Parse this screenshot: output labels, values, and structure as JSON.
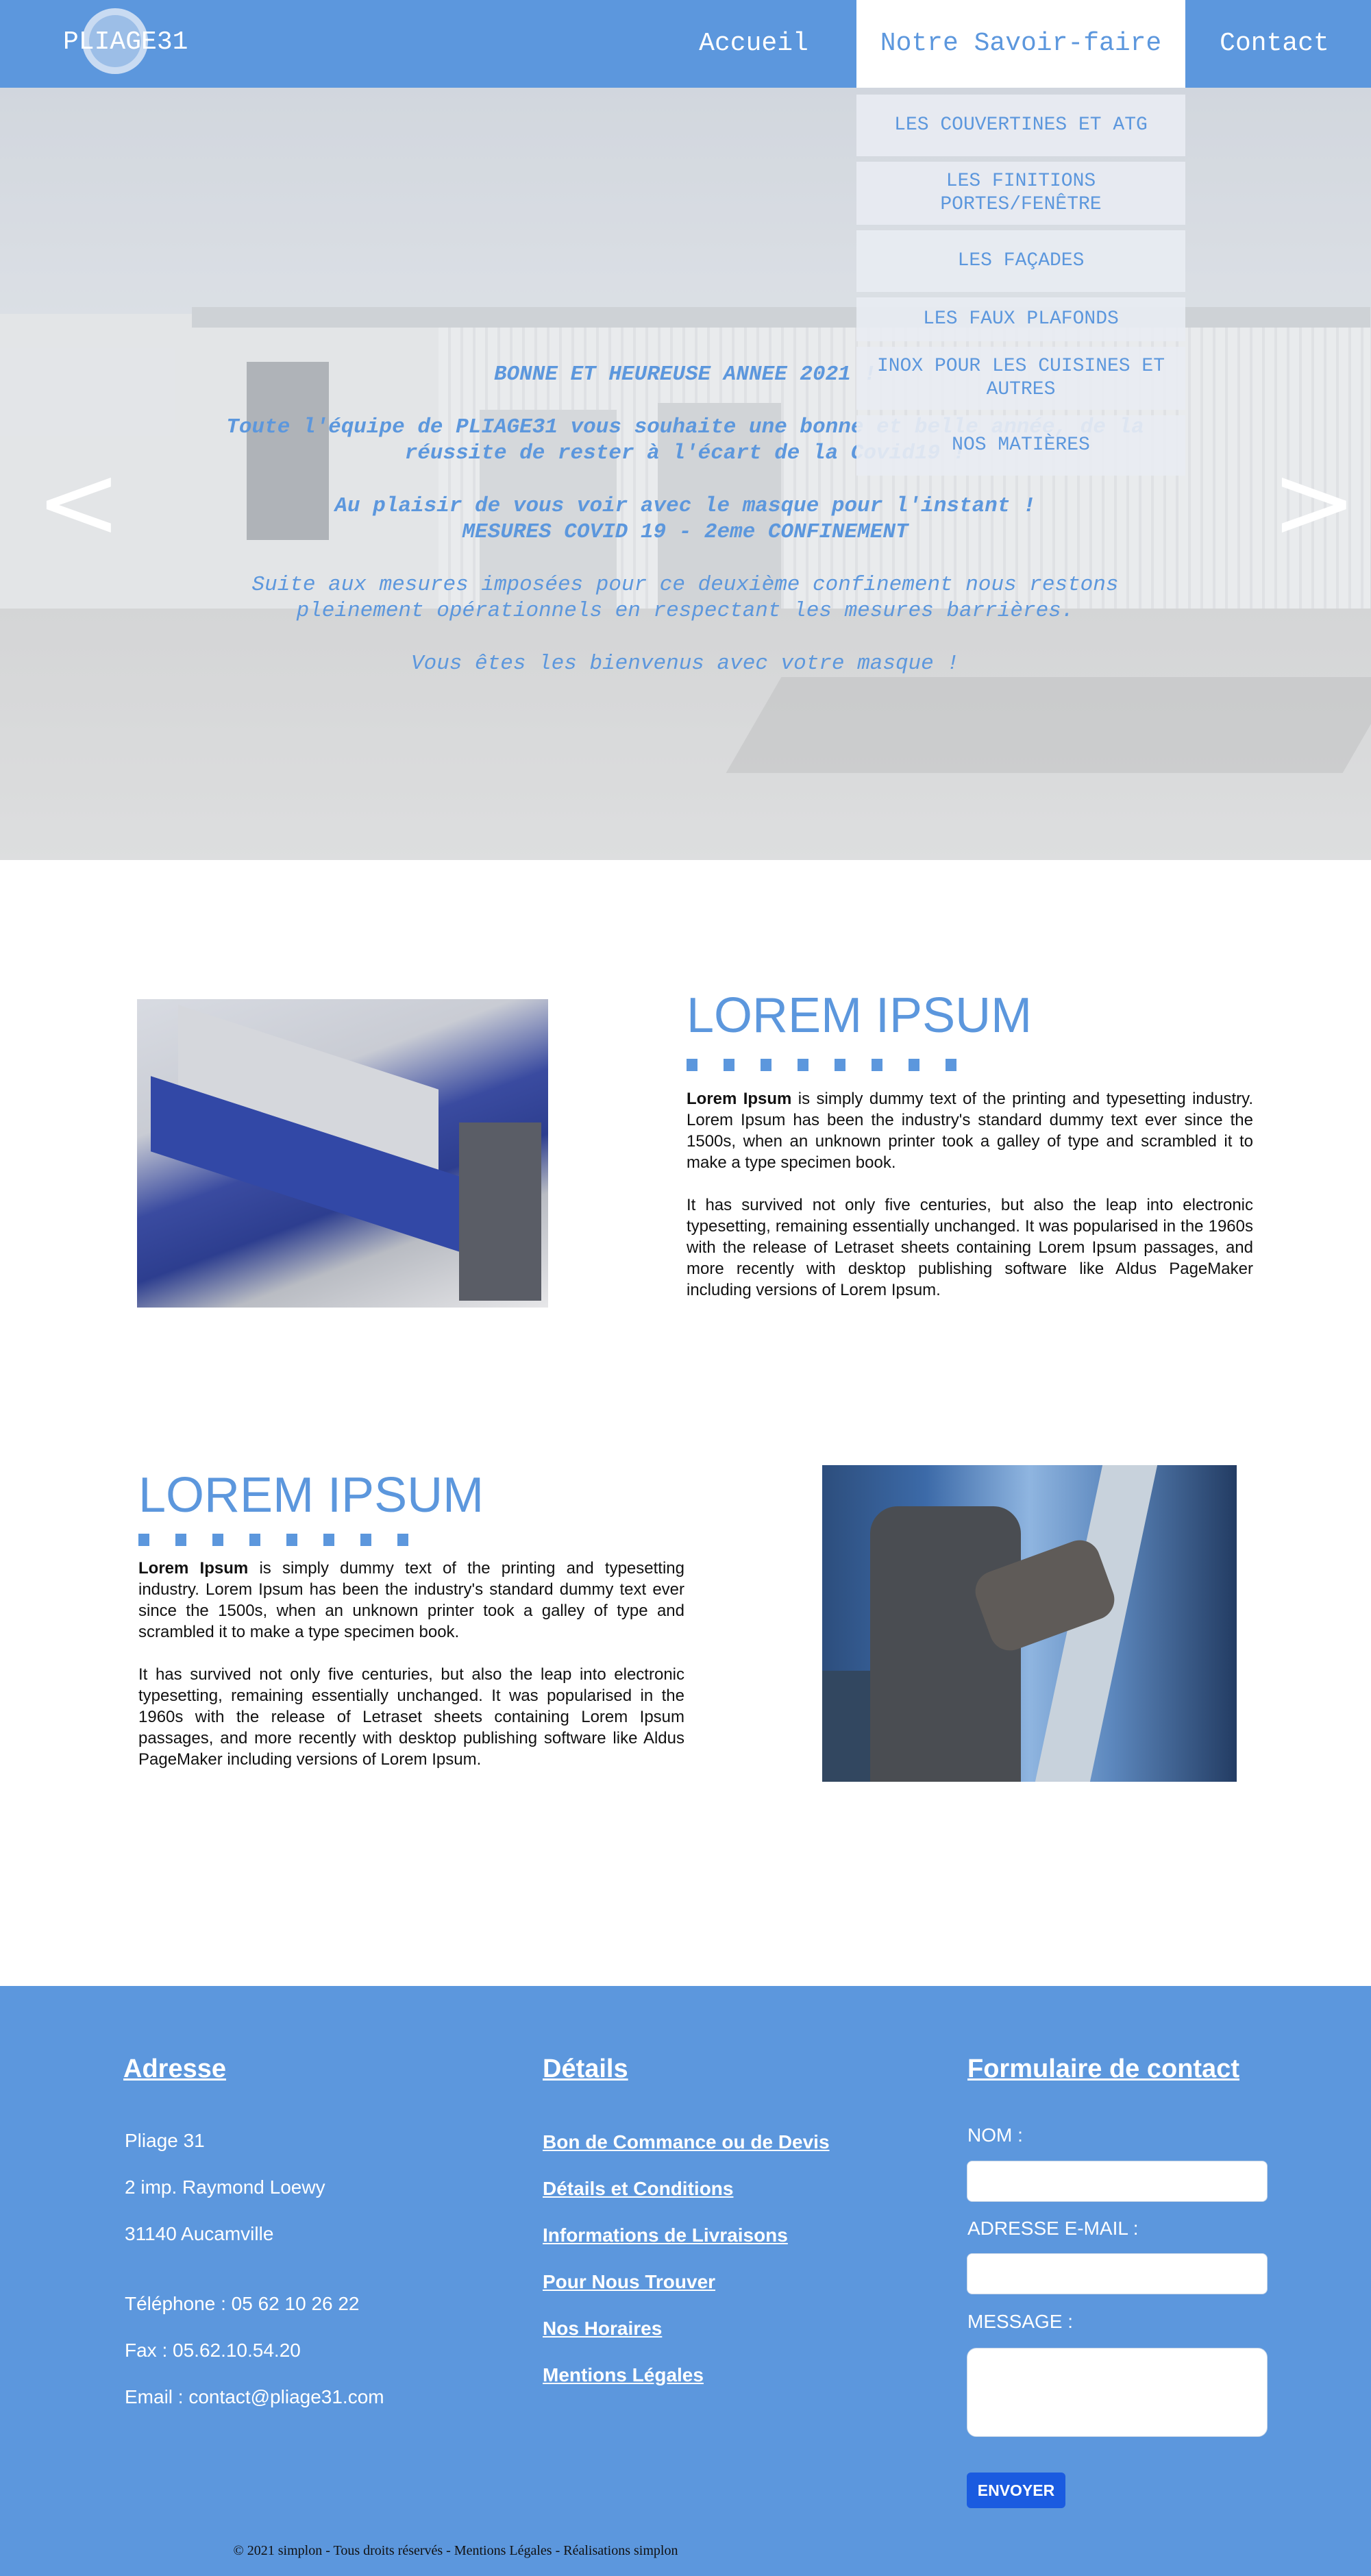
{
  "header": {
    "logo": "PLIAGE31",
    "nav": {
      "accueil": "Accueil",
      "savoir_faire": "Notre Savoir-faire",
      "contact": "Contact"
    }
  },
  "dropdown": [
    "LES COUVERTINES ET ATG",
    "LES FINITIONS PORTES/FENÊTRE",
    "LES FAÇADES",
    "LES FAUX PLAFONDS",
    "INOX POUR LES CUISINES ET AUTRES",
    "NOS MATIÈRES"
  ],
  "hero": {
    "prev": "<",
    "next": ">",
    "line1": "BONNE ET HEUREUSE ANNEE 2021 !",
    "line2": "Toute l'équipe de PLIAGE31 vous souhaite une bonne et belle année, de la réussite de rester à l'écart de la Covid19 !",
    "line3": "Au plaisir de vous voir avec le masque pour l'instant !",
    "line4": "MESURES COVID 19 - 2eme CONFINEMENT",
    "line5": "Suite aux mesures imposées pour ce deuxième confinement nous restons pleinement opérationnels en respectant les mesures barrières.",
    "line6": "Vous êtes les bienvenus avec votre masque !"
  },
  "section1": {
    "title": "LOREM IPSUM",
    "lead": "Lorem Ipsum",
    "p1": " is simply dummy text of the printing and typesetting industry. Lorem Ipsum has been the industry's standard dummy text ever since the 1500s, when an unknown printer took a galley of type and scrambled it to make a type specimen book.",
    "p2": "It has survived not only five centuries, but also the leap into electronic typesetting, remaining essentially unchanged. It was popularised in the 1960s with the release of Letraset sheets containing Lorem Ipsum passages, and more recently with desktop publishing software like Aldus PageMaker including versions of Lorem Ipsum."
  },
  "section2": {
    "title": "LOREM IPSUM",
    "lead": "Lorem Ipsum",
    "p1": " is simply dummy text of the printing and typesetting industry. Lorem Ipsum has been the industry's standard dummy text ever since the 1500s, when an unknown printer took a galley of type and scrambled it to make a type specimen book.",
    "p2": "It has survived not only five centuries, but also the leap into electronic typesetting, remaining essentially unchanged. It was popularised in the 1960s with the release of Letraset sheets containing Lorem Ipsum passages, and more recently with desktop publishing software like Aldus PageMaker including versions of Lorem Ipsum."
  },
  "footer": {
    "address": {
      "title": "Adresse",
      "lines": [
        "Pliage 31",
        "2 imp. Raymond Loewy",
        "31140 Aucamville",
        "Téléphone : 05 62 10 26 22",
        "Fax : 05.62.10.54.20",
        "Email : contact@pliage31.com"
      ]
    },
    "details": {
      "title": "Détails",
      "links": [
        "Bon de Commance ou de Devis",
        "Détails et Conditions",
        "Informations de Livraisons",
        "Pour Nous Trouver",
        "Nos Horaires",
        "Mentions Légales"
      ]
    },
    "form": {
      "title": "Formulaire de contact",
      "name_label": "NOM :",
      "email_label": "ADRESSE E-MAIL :",
      "message_label": "MESSAGE :",
      "submit": "ENVOYER"
    },
    "copyright": "© 2021 simplon - Tous droits réservés - Mentions Légales - Réalisations simplon"
  },
  "colors": {
    "brand": "#5c97dd",
    "button": "#1a5be0"
  },
  "icons": {
    "prev": "chevron-left-icon",
    "next": "chevron-right-icon"
  }
}
